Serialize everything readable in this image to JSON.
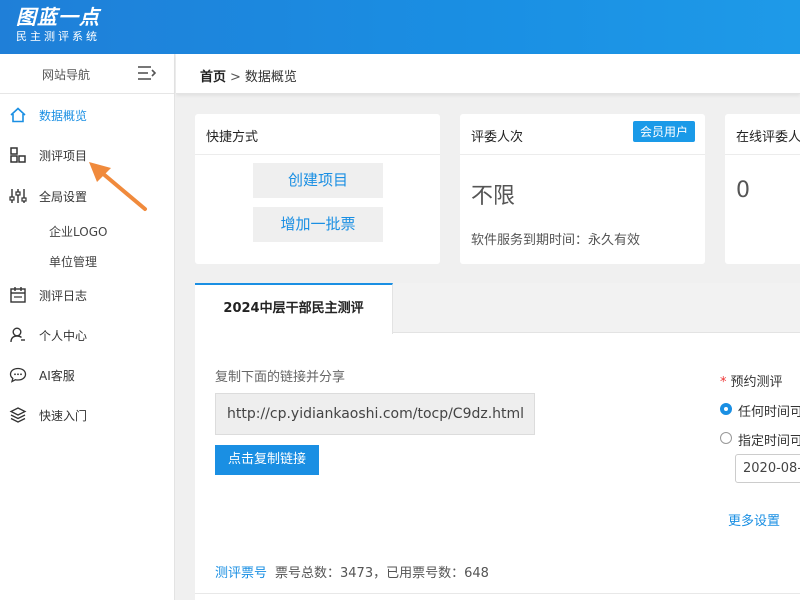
{
  "brand": {
    "name": "图蓝一点",
    "subtitle": "民主测评系统"
  },
  "colors": {
    "accent": "#1a8fe3",
    "arrow": "#f08a3c",
    "required": "#ee3333"
  },
  "sidebar": {
    "header": "网站导航",
    "toggle_icon": "menu-collapse-icon",
    "items": [
      {
        "label": "数据概览",
        "icon": "home-icon"
      },
      {
        "label": "测评项目",
        "icon": "grid-icon"
      },
      {
        "label": "全局设置",
        "icon": "sliders-icon"
      },
      {
        "label": "企业LOGO"
      },
      {
        "label": "单位管理"
      },
      {
        "label": "测评日志",
        "icon": "calendar-icon"
      },
      {
        "label": "个人中心",
        "icon": "user-icon"
      },
      {
        "label": "AI客服",
        "icon": "chat-icon"
      },
      {
        "label": "快速入门",
        "icon": "layers-icon"
      }
    ]
  },
  "breadcrumb": {
    "home": "首页",
    "separator": ">",
    "current": "数据概览"
  },
  "cards": {
    "quick": {
      "title": "快捷方式",
      "buttons": [
        "创建项目",
        "增加一批票"
      ]
    },
    "reviewers": {
      "title": "评委人次",
      "badge": "会员用户",
      "value": "不限",
      "expire": "软件服务到期时间：永久有效"
    },
    "online": {
      "title": "在线评委人",
      "value": "0"
    }
  },
  "project": {
    "tab": "2024中层干部民主测评",
    "share_label": "复制下面的链接并分享",
    "link": "http://cp.yidiankaoshi.com/tocp/C9dz.html",
    "copy_button": "点击复制链接",
    "reserve": {
      "required_mark": "*",
      "label": "预约测评",
      "options": [
        {
          "label": "任何时间可",
          "checked": true
        },
        {
          "label": "指定时间可",
          "checked": false
        }
      ],
      "date": "2020-08-"
    },
    "more_settings": "更多设置",
    "tickets": {
      "link": "测评票号",
      "summary": "票号总数：3473，已用票号数：648"
    }
  }
}
